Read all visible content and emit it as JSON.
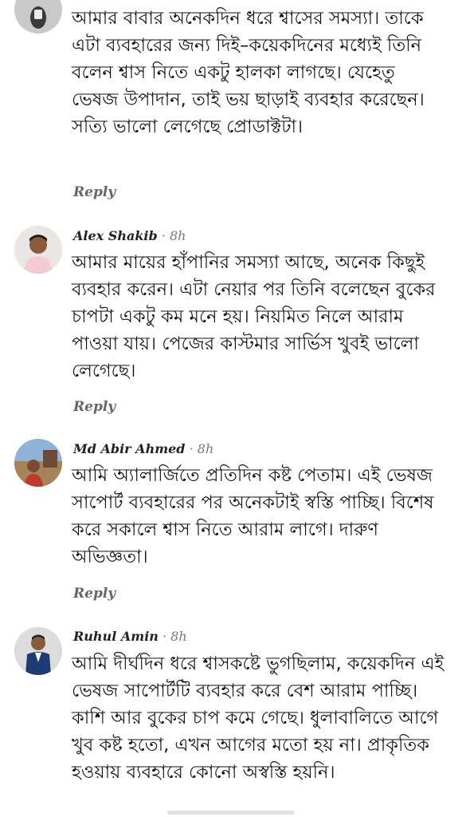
{
  "comments": [
    {
      "text": "আমার বাবার অনেকদিন ধরে শ্বাসের সমস্যা। তাকে এটা ব্যবহারের জন্য দিই–কয়েকদিনের মধ্যেই তিনি বলেন শ্বাস নিতে একটু হালকা লাগছে। যেহেতু ভেষজ উপাদান, তাই ভয় ছাড়াই ব্যবহার করেছেন। সত্যি ভালো লেগেছে প্রোডাক্টটা।",
      "reply": "Reply"
    },
    {
      "name": "Alex Shakib",
      "time": "· 8h",
      "text": "আমার মায়ের হাঁপানির সমস্যা আছে, অনেক কিছুই ব্যবহার করেন। এটা নেয়ার পর তিনি বলেছেন বুকের চাপটা একটু কম মনে হয়। নিয়মিত নিলে আরাম পাওয়া যায়। পেজের কাস্টমার সার্ভিস খুবই ভালো লেগেছে।",
      "reply": "Reply"
    },
    {
      "name": "Md Abir Ahmed",
      "time": "· 8h",
      "text": "আমি অ্যালার্জিতে প্রতিদিন কষ্ট পেতাম। এই ভেষজ সাপোর্ট ব্যবহারের পর অনেকটাই স্বস্তি পাচ্ছি। বিশেষ করে সকালে শ্বাস নিতে আরাম লাগে। দারুণ অভিজ্ঞতা।",
      "reply": "Reply"
    },
    {
      "name": "Ruhul Amin",
      "time": "· 8h",
      "text": "আমি দীর্ঘদিন ধরে শ্বাসকষ্টে ভুগছিলাম, কয়েকদিন এই ভেষজ সাপোর্টটি ব্যবহার করে বেশ আরাম পাচ্ছি। কাশি আর বুকের চাপ কমে গেছে। ধুলাবালিতে আগে খুব কষ্ট হতো, এখন আগের মতো হয় না। প্রাকৃতিক হওয়ায় ব্যবহারে কোনো অস্বস্তি হয়নি।"
    }
  ]
}
